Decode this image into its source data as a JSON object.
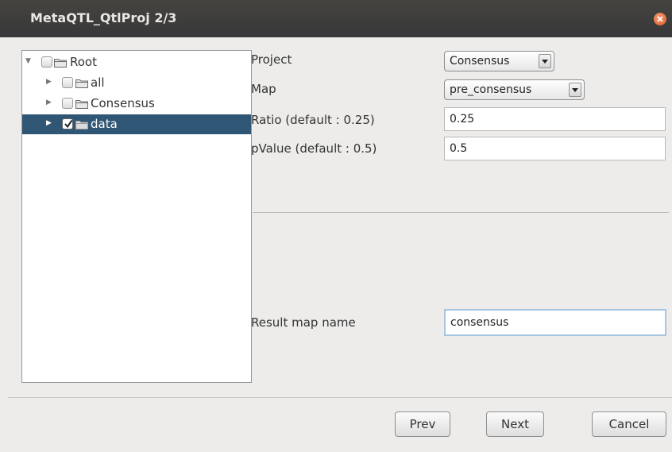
{
  "window": {
    "title": "MetaQTL_QtlProj 2/3"
  },
  "tree": {
    "root": {
      "label": "Root",
      "checked": false,
      "expanded": true
    },
    "items": [
      {
        "label": "all",
        "checked": false,
        "selected": false
      },
      {
        "label": "Consensus",
        "checked": false,
        "selected": false
      },
      {
        "label": "data",
        "checked": true,
        "selected": true
      }
    ]
  },
  "form": {
    "project": {
      "label": "Project",
      "value": "Consensus"
    },
    "map": {
      "label": "Map",
      "value": "pre_consensus"
    },
    "ratio": {
      "label": "Ratio (default : 0.25)",
      "value": "0.25"
    },
    "pvalue": {
      "label": "pValue (default : 0.5)",
      "value": "0.5"
    },
    "result_map_name": {
      "label": "Result map name",
      "value": "consensus"
    }
  },
  "buttons": {
    "prev": "Prev",
    "next": "Next",
    "cancel": "Cancel"
  },
  "colors": {
    "titlebar": "#3c3b37",
    "selection": "#2f5674",
    "close": "#df5a24",
    "background": "#edeceb"
  }
}
